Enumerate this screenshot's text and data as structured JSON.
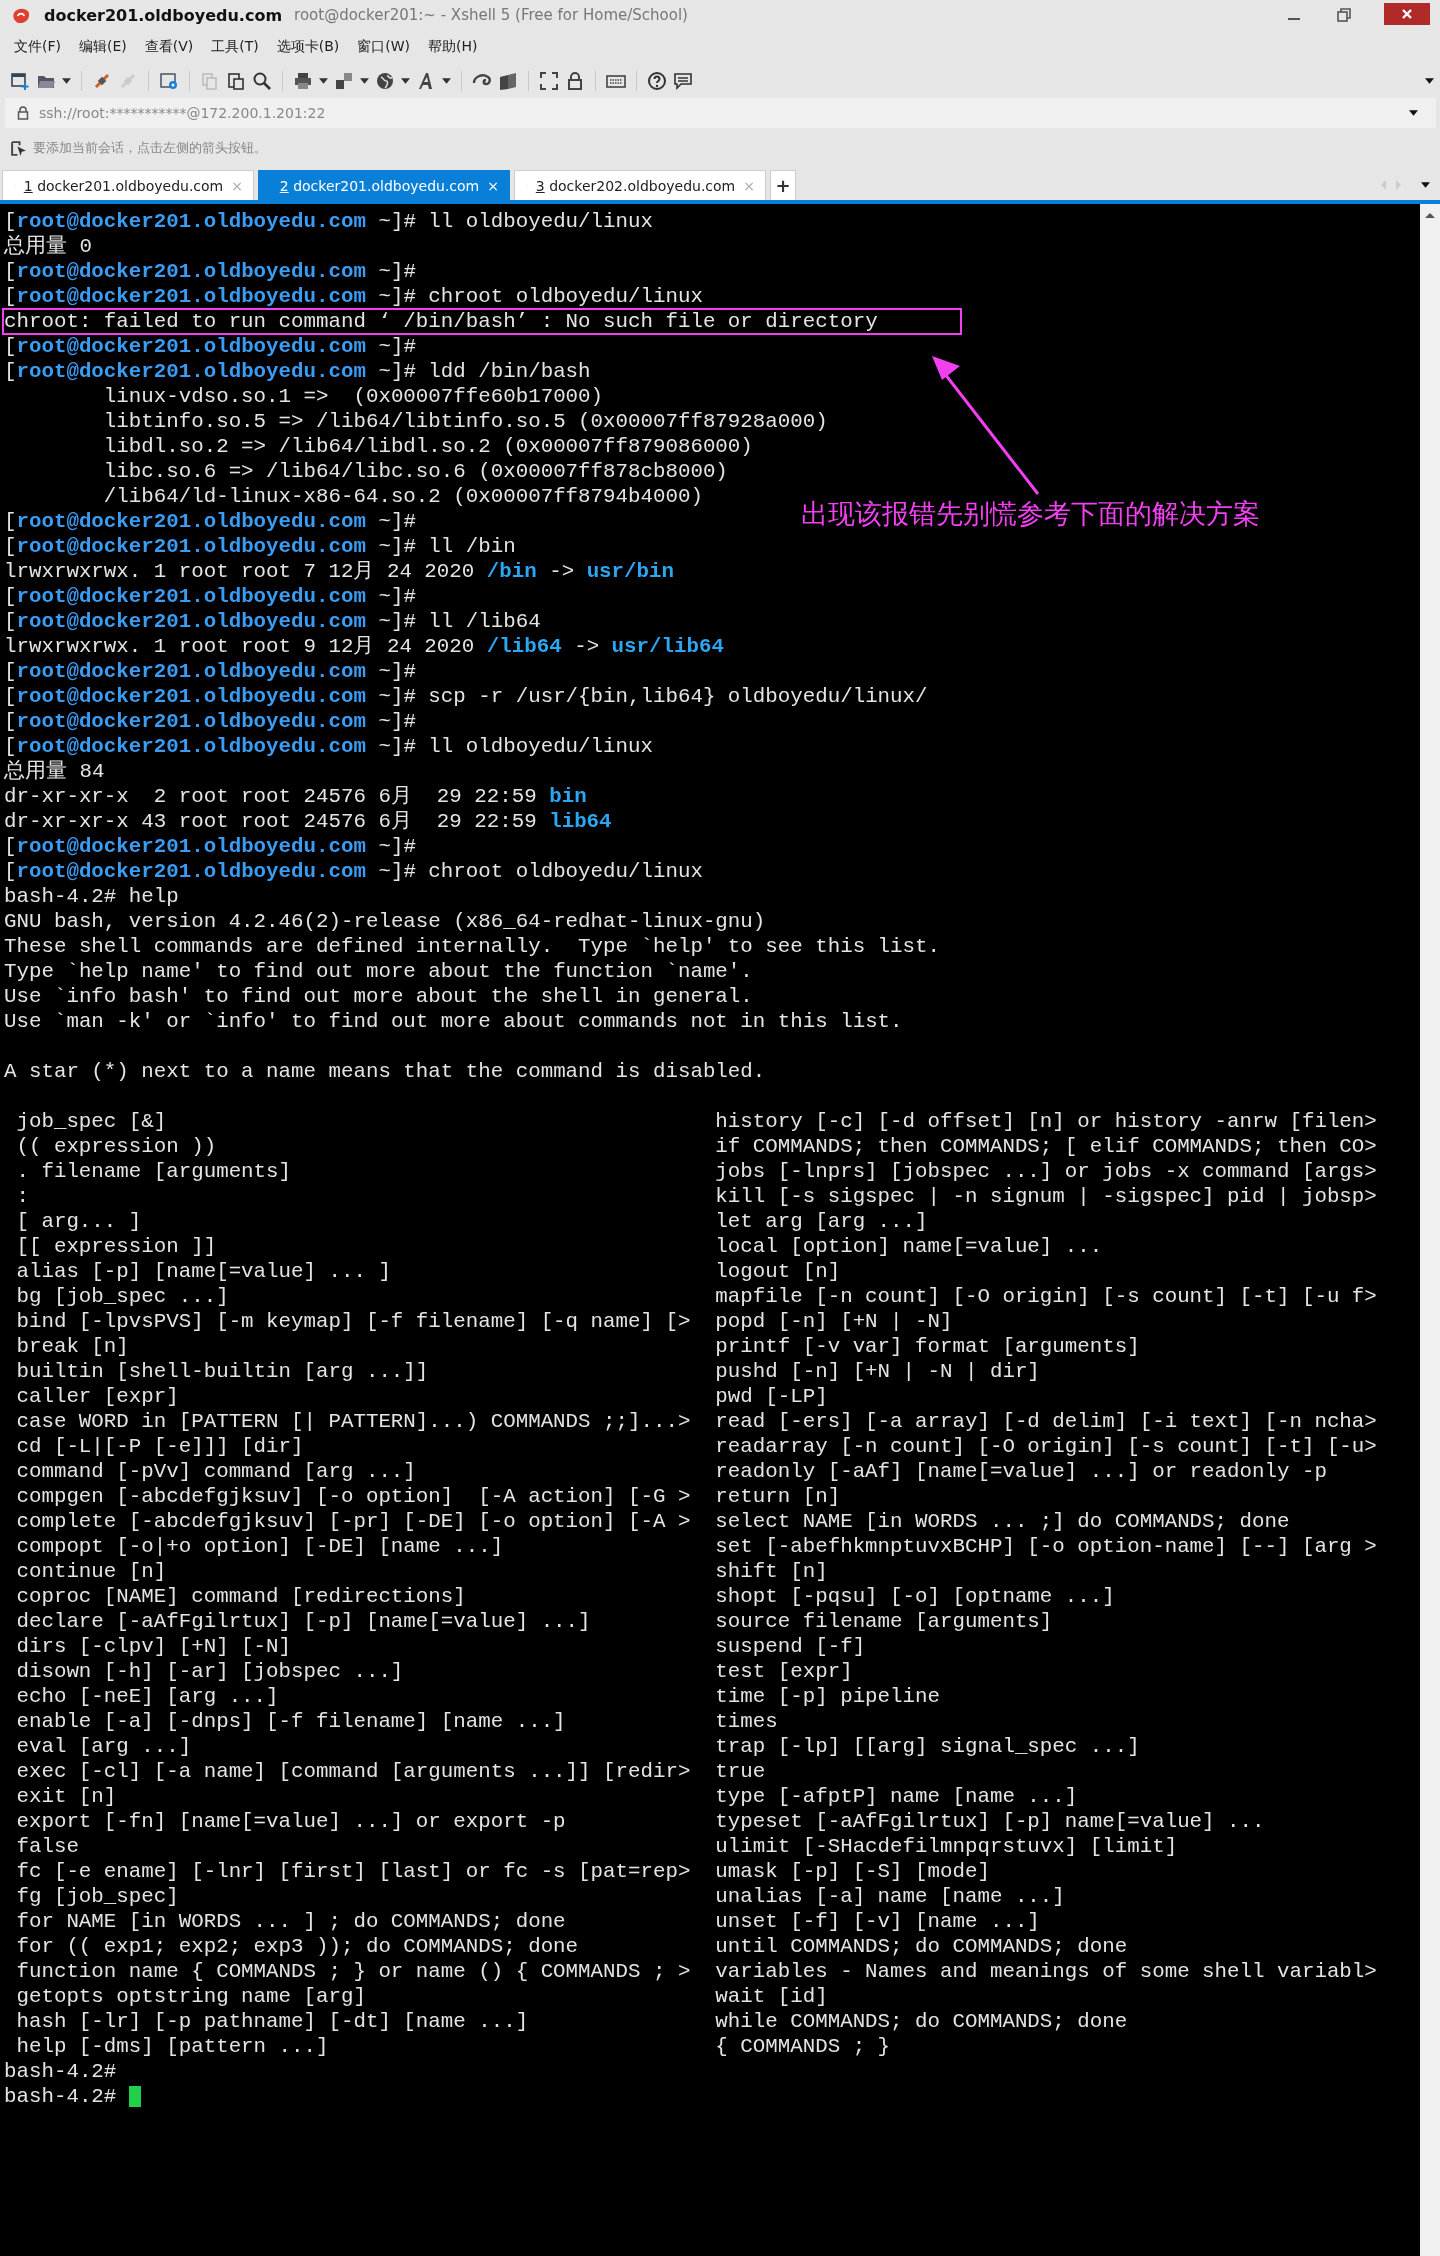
{
  "window": {
    "title": "docker201.oldboyedu.com",
    "subtitle": "root@docker201:~ - Xshell 5 (Free for Home/School)"
  },
  "menu": [
    "文件(F)",
    "编辑(E)",
    "查看(V)",
    "工具(T)",
    "选项卡(B)",
    "窗口(W)",
    "帮助(H)"
  ],
  "address": {
    "value": "ssh://root:***********@172.200.1.201:22"
  },
  "hint": "要添加当前会话，点击左侧的箭头按钮。",
  "tabs": [
    {
      "number": "1",
      "label": "docker201.oldboyedu.com",
      "close": "×",
      "selected": false
    },
    {
      "number": "2",
      "label": "docker201.oldboyedu.com",
      "close": "×",
      "selected": true
    },
    {
      "number": "3",
      "label": "docker202.oldboyedu.com",
      "close": "×",
      "selected": false
    }
  ],
  "new_tab": "+",
  "terminal": {
    "lines": [
      {
        "kind": "text",
        "parts": [
          {
            "text": "[",
            "kind": "plain"
          },
          {
            "text": "root@docker201.oldboyedu.com",
            "kind": "host"
          },
          {
            "text": " ~]# ll oldboyedu/linux",
            "kind": "plain"
          }
        ]
      },
      {
        "kind": "text",
        "parts": [
          {
            "text": "总用量 0",
            "kind": "plain"
          }
        ]
      },
      {
        "kind": "text",
        "parts": [
          {
            "text": "[",
            "kind": "plain"
          },
          {
            "text": "root@docker201.oldboyedu.com",
            "kind": "host"
          },
          {
            "text": " ~]#",
            "kind": "plain"
          }
        ]
      },
      {
        "kind": "text",
        "parts": [
          {
            "text": "[",
            "kind": "plain"
          },
          {
            "text": "root@docker201.oldboyedu.com",
            "kind": "host"
          },
          {
            "text": " ~]# chroot oldboyedu/linux",
            "kind": "plain"
          }
        ]
      },
      {
        "kind": "text",
        "parts": [
          {
            "text": "chroot: failed to run command ‘ /bin/bash’ : No such file or directory",
            "kind": "plain"
          }
        ],
        "highlighted": true
      },
      {
        "kind": "text",
        "parts": [
          {
            "text": "[",
            "kind": "plain"
          },
          {
            "text": "root@docker201.oldboyedu.com",
            "kind": "host"
          },
          {
            "text": " ~]#",
            "kind": "plain"
          }
        ]
      },
      {
        "kind": "text",
        "parts": [
          {
            "text": "[",
            "kind": "plain"
          },
          {
            "text": "root@docker201.oldboyedu.com",
            "kind": "host"
          },
          {
            "text": " ~]# ldd /bin/bash",
            "kind": "plain"
          }
        ]
      },
      {
        "kind": "text",
        "parts": [
          {
            "text": "        linux-vdso.so.1 =>  (0x00007ffe60b17000)",
            "kind": "plain"
          }
        ]
      },
      {
        "kind": "text",
        "parts": [
          {
            "text": "        libtinfo.so.5 => /lib64/libtinfo.so.5 (0x00007ff87928a000)",
            "kind": "plain"
          }
        ]
      },
      {
        "kind": "text",
        "parts": [
          {
            "text": "        libdl.so.2 => /lib64/libdl.so.2 (0x00007ff879086000)",
            "kind": "plain"
          }
        ]
      },
      {
        "kind": "text",
        "parts": [
          {
            "text": "        libc.so.6 => /lib64/libc.so.6 (0x00007ff878cb8000)",
            "kind": "plain"
          }
        ]
      },
      {
        "kind": "text",
        "parts": [
          {
            "text": "        /lib64/ld-linux-x86-64.so.2 (0x00007ff8794b4000)",
            "kind": "plain"
          }
        ]
      },
      {
        "kind": "text",
        "parts": [
          {
            "text": "[",
            "kind": "plain"
          },
          {
            "text": "root@docker201.oldboyedu.com",
            "kind": "host"
          },
          {
            "text": " ~]#",
            "kind": "plain"
          }
        ]
      },
      {
        "kind": "text",
        "parts": [
          {
            "text": "[",
            "kind": "plain"
          },
          {
            "text": "root@docker201.oldboyedu.com",
            "kind": "host"
          },
          {
            "text": " ~]# ll /bin",
            "kind": "plain"
          }
        ]
      },
      {
        "kind": "text",
        "parts": [
          {
            "text": "lrwxrwxrwx. 1 root root 7 12月 24 2020 ",
            "kind": "plain"
          },
          {
            "text": "/bin",
            "kind": "dir"
          },
          {
            "text": " -> ",
            "kind": "plain"
          },
          {
            "text": "usr/bin",
            "kind": "dir"
          }
        ]
      },
      {
        "kind": "text",
        "parts": [
          {
            "text": "[",
            "kind": "plain"
          },
          {
            "text": "root@docker201.oldboyedu.com",
            "kind": "host"
          },
          {
            "text": " ~]#",
            "kind": "plain"
          }
        ]
      },
      {
        "kind": "text",
        "parts": [
          {
            "text": "[",
            "kind": "plain"
          },
          {
            "text": "root@docker201.oldboyedu.com",
            "kind": "host"
          },
          {
            "text": " ~]# ll /lib64",
            "kind": "plain"
          }
        ]
      },
      {
        "kind": "text",
        "parts": [
          {
            "text": "lrwxrwxrwx. 1 root root 9 12月 24 2020 ",
            "kind": "plain"
          },
          {
            "text": "/lib64",
            "kind": "dir"
          },
          {
            "text": " -> ",
            "kind": "plain"
          },
          {
            "text": "usr/lib64",
            "kind": "dir"
          }
        ]
      },
      {
        "kind": "text",
        "parts": [
          {
            "text": "[",
            "kind": "plain"
          },
          {
            "text": "root@docker201.oldboyedu.com",
            "kind": "host"
          },
          {
            "text": " ~]#",
            "kind": "plain"
          }
        ]
      },
      {
        "kind": "text",
        "parts": [
          {
            "text": "[",
            "kind": "plain"
          },
          {
            "text": "root@docker201.oldboyedu.com",
            "kind": "host"
          },
          {
            "text": " ~]# scp -r /usr/{bin,lib64} oldboyedu/linux/",
            "kind": "plain"
          }
        ]
      },
      {
        "kind": "text",
        "parts": [
          {
            "text": "[",
            "kind": "plain"
          },
          {
            "text": "root@docker201.oldboyedu.com",
            "kind": "host"
          },
          {
            "text": " ~]#",
            "kind": "plain"
          }
        ]
      },
      {
        "kind": "text",
        "parts": [
          {
            "text": "[",
            "kind": "plain"
          },
          {
            "text": "root@docker201.oldboyedu.com",
            "kind": "host"
          },
          {
            "text": " ~]# ll oldboyedu/linux",
            "kind": "plain"
          }
        ]
      },
      {
        "kind": "text",
        "parts": [
          {
            "text": "总用量 84",
            "kind": "plain"
          }
        ]
      },
      {
        "kind": "text",
        "parts": [
          {
            "text": "dr-xr-xr-x  2 root root 24576 6月  29 22:59 ",
            "kind": "plain"
          },
          {
            "text": "bin",
            "kind": "dir"
          }
        ]
      },
      {
        "kind": "text",
        "parts": [
          {
            "text": "dr-xr-xr-x 43 root root 24576 6月  29 22:59 ",
            "kind": "plain"
          },
          {
            "text": "lib64",
            "kind": "dir"
          }
        ]
      },
      {
        "kind": "text",
        "parts": [
          {
            "text": "[",
            "kind": "plain"
          },
          {
            "text": "root@docker201.oldboyedu.com",
            "kind": "host"
          },
          {
            "text": " ~]#",
            "kind": "plain"
          }
        ]
      },
      {
        "kind": "text",
        "parts": [
          {
            "text": "[",
            "kind": "plain"
          },
          {
            "text": "root@docker201.oldboyedu.com",
            "kind": "host"
          },
          {
            "text": " ~]# chroot oldboyedu/linux",
            "kind": "plain"
          }
        ]
      },
      {
        "kind": "text",
        "parts": [
          {
            "text": "bash-4.2# help",
            "kind": "plain"
          }
        ]
      },
      {
        "kind": "text",
        "parts": [
          {
            "text": "GNU bash, version 4.2.46(2)-release (x86_64-redhat-linux-gnu)",
            "kind": "plain"
          }
        ]
      },
      {
        "kind": "text",
        "parts": [
          {
            "text": "These shell commands are defined internally.  Type `help' to see this list.",
            "kind": "plain"
          }
        ]
      },
      {
        "kind": "text",
        "parts": [
          {
            "text": "Type `help name' to find out more about the function `name'.",
            "kind": "plain"
          }
        ]
      },
      {
        "kind": "text",
        "parts": [
          {
            "text": "Use `info bash' to find out more about the shell in general.",
            "kind": "plain"
          }
        ]
      },
      {
        "kind": "text",
        "parts": [
          {
            "text": "Use `man -k' or `info' to find out more about commands not in this list.",
            "kind": "plain"
          }
        ]
      },
      {
        "kind": "blank"
      },
      {
        "kind": "text",
        "parts": [
          {
            "text": "A star (*) next to a name means that the command is disabled.",
            "kind": "plain"
          }
        ]
      },
      {
        "kind": "blank"
      }
    ],
    "help_rows": [
      {
        "left": "job_spec [&]",
        "right": "history [-c] [-d offset] [n] or history -anrw [filen>"
      },
      {
        "left": "(( expression ))",
        "right": "if COMMANDS; then COMMANDS; [ elif COMMANDS; then CO>"
      },
      {
        "left": ". filename [arguments]",
        "right": "jobs [-lnprs] [jobspec ...] or jobs -x command [args>"
      },
      {
        "left": ":",
        "right": "kill [-s sigspec | -n signum | -sigspec] pid | jobsp>"
      },
      {
        "left": "[ arg... ]",
        "right": "let arg [arg ...]"
      },
      {
        "left": "[[ expression ]]",
        "right": "local [option] name[=value] ..."
      },
      {
        "left": "alias [-p] [name[=value] ... ]",
        "right": "logout [n]"
      },
      {
        "left": "bg [job_spec ...]",
        "right": "mapfile [-n count] [-O origin] [-s count] [-t] [-u f>"
      },
      {
        "left": "bind [-lpvsPVS] [-m keymap] [-f filename] [-q name] [>",
        "right": "popd [-n] [+N | -N]"
      },
      {
        "left": "break [n]",
        "right": "printf [-v var] format [arguments]"
      },
      {
        "left": "builtin [shell-builtin [arg ...]]",
        "right": "pushd [-n] [+N | -N | dir]"
      },
      {
        "left": "caller [expr]",
        "right": "pwd [-LP]"
      },
      {
        "left": "case WORD in [PATTERN [| PATTERN]...) COMMANDS ;;]...>",
        "right": "read [-ers] [-a array] [-d delim] [-i text] [-n ncha>"
      },
      {
        "left": "cd [-L|[-P [-e]]] [dir]",
        "right": "readarray [-n count] [-O origin] [-s count] [-t] [-u>"
      },
      {
        "left": "command [-pVv] command [arg ...]",
        "right": "readonly [-aAf] [name[=value] ...] or readonly -p"
      },
      {
        "left": "compgen [-abcdefgjksuv] [-o option]  [-A action] [-G >",
        "right": "return [n]"
      },
      {
        "left": "complete [-abcdefgjksuv] [-pr] [-DE] [-o option] [-A >",
        "right": "select NAME [in WORDS ... ;] do COMMANDS; done"
      },
      {
        "left": "compopt [-o|+o option] [-DE] [name ...]",
        "right": "set [-abefhkmnptuvxBCHP] [-o option-name] [--] [arg >"
      },
      {
        "left": "continue [n]",
        "right": "shift [n]"
      },
      {
        "left": "coproc [NAME] command [redirections]",
        "right": "shopt [-pqsu] [-o] [optname ...]"
      },
      {
        "left": "declare [-aAfFgilrtux] [-p] [name[=value] ...]",
        "right": "source filename [arguments]"
      },
      {
        "left": "dirs [-clpv] [+N] [-N]",
        "right": "suspend [-f]"
      },
      {
        "left": "disown [-h] [-ar] [jobspec ...]",
        "right": "test [expr]"
      },
      {
        "left": "echo [-neE] [arg ...]",
        "right": "time [-p] pipeline"
      },
      {
        "left": "enable [-a] [-dnps] [-f filename] [name ...]",
        "right": "times"
      },
      {
        "left": "eval [arg ...]",
        "right": "trap [-lp] [[arg] signal_spec ...]"
      },
      {
        "left": "exec [-cl] [-a name] [command [arguments ...]] [redir>",
        "right": "true"
      },
      {
        "left": "exit [n]",
        "right": "type [-afptP] name [name ...]"
      },
      {
        "left": "export [-fn] [name[=value] ...] or export -p",
        "right": "typeset [-aAfFgilrtux] [-p] name[=value] ..."
      },
      {
        "left": "false",
        "right": "ulimit [-SHacdefilmnpqrstuvx] [limit]"
      },
      {
        "left": "fc [-e ename] [-lnr] [first] [last] or fc -s [pat=rep>",
        "right": "umask [-p] [-S] [mode]"
      },
      {
        "left": "fg [job_spec]",
        "right": "unalias [-a] name [name ...]"
      },
      {
        "left": "for NAME [in WORDS ... ] ; do COMMANDS; done",
        "right": "unset [-f] [-v] [name ...]"
      },
      {
        "left": "for (( exp1; exp2; exp3 )); do COMMANDS; done",
        "right": "until COMMANDS; do COMMANDS; done"
      },
      {
        "left": "function name { COMMANDS ; } or name () { COMMANDS ; >",
        "right": "variables - Names and meanings of some shell variabl>"
      },
      {
        "left": "getopts optstring name [arg]",
        "right": "wait [id]"
      },
      {
        "left": "hash [-lr] [-p pathname] [-dt] [name ...]",
        "right": "while COMMANDS; do COMMANDS; done"
      },
      {
        "left": "help [-dms] [pattern ...]",
        "right": "{ COMMANDS ; }"
      }
    ],
    "tail_lines": [
      {
        "text": "bash-4.2#"
      },
      {
        "text": "bash-4.2#",
        "cursor": true
      }
    ]
  },
  "annotation": "出现该报错先别慌参考下面的解决方案"
}
